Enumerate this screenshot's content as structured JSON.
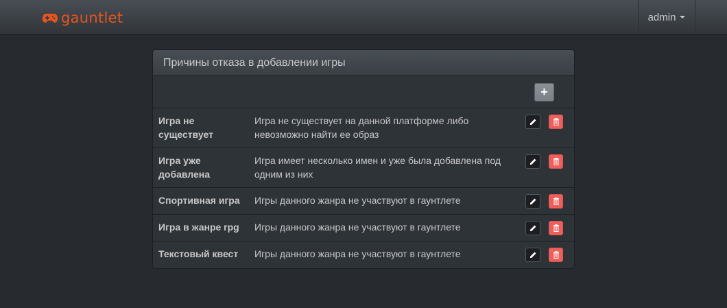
{
  "navbar": {
    "brand": "gauntlet",
    "user_label": "admin",
    "brand_color": "#e8541e"
  },
  "panel": {
    "title": "Причины отказа в добавлении игры",
    "add_button_label": "+",
    "rows": [
      {
        "name": "Игра не существует",
        "description": "Игра не существует на данной платформе либо невозможно найти ее образ"
      },
      {
        "name": "Игра уже добавлена",
        "description": "Игра имеет несколько имен и уже была добавлена под одним из них"
      },
      {
        "name": "Спортивная игра",
        "description": "Игры данного жанра не участвуют в гаунтлете"
      },
      {
        "name": "Игра в жанре rpg",
        "description": "Игры данного жанра не участвуют в гаунтлете"
      },
      {
        "name": "Текстовый квест",
        "description": "Игры данного жанра не участвуют в гаунтлете"
      }
    ]
  },
  "icons": {
    "brand": "gamepad-icon",
    "add": "plus-icon",
    "edit": "pencil-icon",
    "delete": "trash-icon",
    "user_menu": "caret-down-icon"
  },
  "colors": {
    "delete_button": "#ee5f5b",
    "edit_button": "#1c1e22",
    "add_button": "#7a8288"
  }
}
